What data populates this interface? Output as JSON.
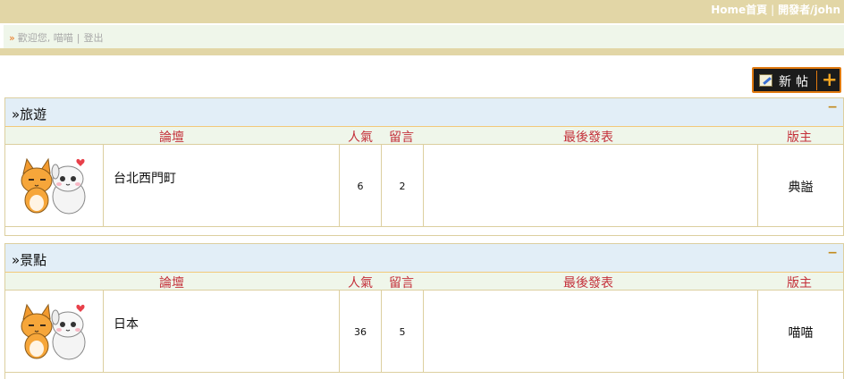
{
  "topbar": {
    "home": "Home首頁",
    "separator": "|",
    "developer": "開發者/john"
  },
  "welcome": {
    "arrow": "»",
    "greeting": "歡迎您, 喵喵",
    "separator": "|",
    "logout": "登出"
  },
  "new_post": {
    "label": "新帖",
    "plus": "+"
  },
  "columns": {
    "forum": "論壇",
    "popularity": "人氣",
    "comments": "留言",
    "last_post": "最後發表",
    "moderator": "版主"
  },
  "categories": [
    {
      "title": "»旅遊",
      "collapse": "−",
      "forum_name": "台北西門町",
      "popularity": "6",
      "comments": "2",
      "last_post": "",
      "moderator": "典謚"
    },
    {
      "title": "»景點",
      "collapse": "−",
      "forum_name": "日本",
      "popularity": "36",
      "comments": "5",
      "last_post": "",
      "moderator": "喵喵"
    }
  ],
  "colors": {
    "tan": "#e2d6a6",
    "header_blue": "#e2eef7",
    "column_red": "#c4303a",
    "accent_orange": "#e07a10"
  }
}
